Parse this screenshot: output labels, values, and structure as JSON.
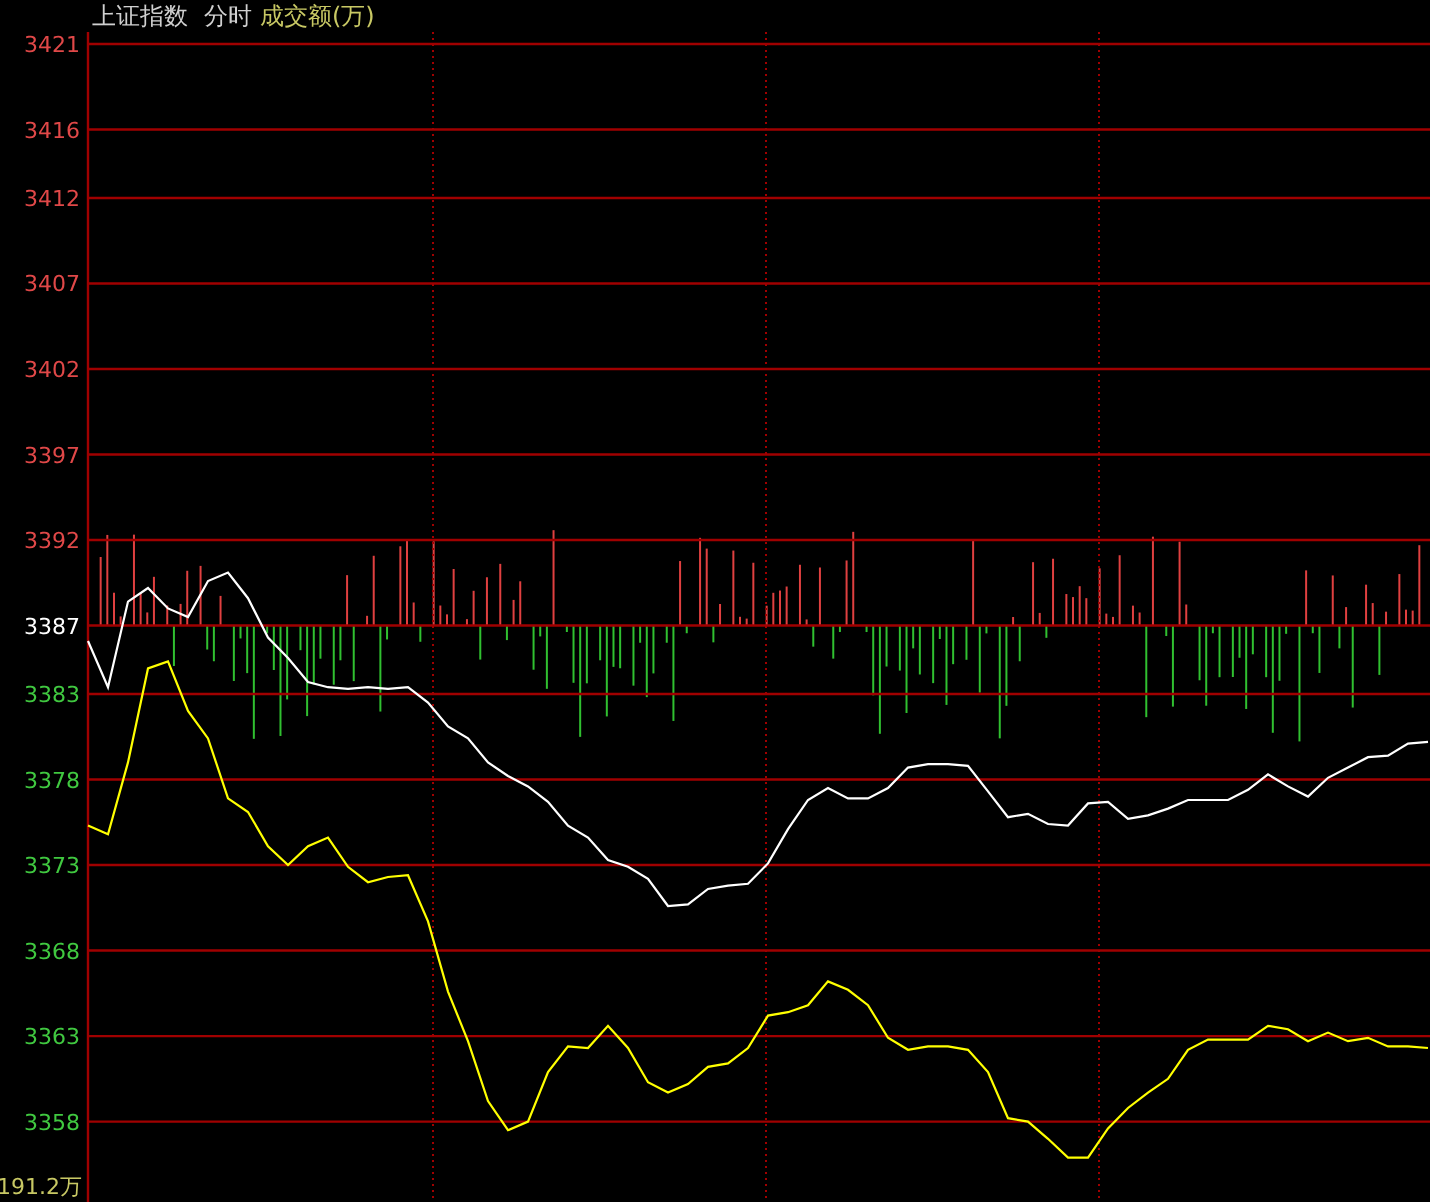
{
  "header": {
    "index_name": "上证指数",
    "period": "分时",
    "indicator": "成交额(万)"
  },
  "chart_data": {
    "type": "line",
    "grid": true,
    "ylim": [
      3353.3,
      3421
    ],
    "yticks": [
      3421,
      3416,
      3412,
      3407,
      3402,
      3397,
      3392,
      3387,
      3383,
      3378,
      3373,
      3368,
      3363,
      3358
    ],
    "series": [
      {
        "color": "#ffffff",
        "values": [
          3386.1,
          3383.4,
          3388.4,
          3389.2,
          3388.0,
          3387.5,
          3389.6,
          3390.1,
          3388.6,
          3386.3,
          3385.1,
          3383.7,
          3383.4,
          3383.3,
          3383.4,
          3383.3,
          3383.4,
          3382.5,
          3381.1,
          3380.4,
          3379.0,
          3378.2,
          3377.6,
          3376.7,
          3375.3,
          3374.6,
          3373.3,
          3372.9,
          3372.2,
          3370.6,
          3370.7,
          3371.6,
          3371.8,
          3371.9,
          3373.1,
          3375.1,
          3376.8,
          3377.5,
          3376.9,
          3376.9,
          3377.5,
          3378.7,
          3378.9,
          3378.9,
          3378.8,
          3377.3,
          3375.8,
          3376.0,
          3375.4,
          3375.3,
          3376.6,
          3376.7,
          3375.7,
          3375.9,
          3376.3,
          3376.8,
          3376.8,
          3376.8,
          3377.4,
          3378.3,
          3377.6,
          3377.0,
          3378.1,
          3378.7,
          3379.3,
          3379.4,
          3380.1,
          3380.2
        ]
      },
      {
        "color": "#ffff00",
        "values": [
          3375.3,
          3374.8,
          3379.0,
          3384.5,
          3384.9,
          3382.0,
          3380.4,
          3376.9,
          3376.1,
          3374.1,
          3373.0,
          3374.1,
          3374.6,
          3372.9,
          3372.0,
          3372.3,
          3372.4,
          3369.7,
          3365.6,
          3362.7,
          3359.2,
          3357.5,
          3358.0,
          3360.9,
          3362.4,
          3362.3,
          3363.6,
          3362.3,
          3360.3,
          3359.7,
          3360.2,
          3361.2,
          3361.4,
          3362.3,
          3364.2,
          3364.4,
          3364.8,
          3366.2,
          3365.7,
          3364.8,
          3362.9,
          3362.2,
          3362.4,
          3362.4,
          3362.2,
          3360.9,
          3358.2,
          3358.0,
          3357.0,
          3355.9,
          3355.9,
          3357.6,
          3358.8,
          3359.7,
          3360.5,
          3362.2,
          3362.8,
          3362.8,
          3362.8,
          3363.6,
          3363.4,
          3362.7,
          3363.2,
          3362.7,
          3362.9,
          3362.4,
          3362.4,
          3362.3
        ]
      }
    ]
  },
  "volume_label": "191.2万"
}
